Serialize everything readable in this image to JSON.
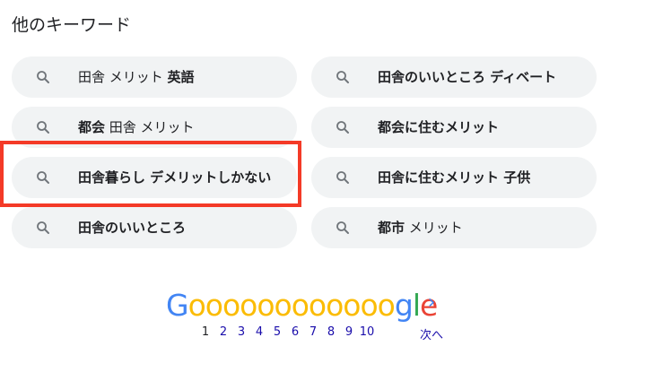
{
  "section_title": "他のキーワード",
  "left_chips": [
    {
      "plain": "田舎 メリット ",
      "bold": "英語"
    },
    {
      "bold": "都会",
      "plain": " 田舎 メリット",
      "underlined": true
    },
    {
      "bold": "田舎暮らし デメリットしかない",
      "plain": ""
    },
    {
      "bold": "田舎のいいところ",
      "plain": ""
    }
  ],
  "right_chips": [
    {
      "bold": "田舎のいいところ ディベート",
      "plain": ""
    },
    {
      "bold": "都会に住むメリット",
      "plain": ""
    },
    {
      "bold": "田舎に住むメリット 子供",
      "plain": ""
    },
    {
      "bold": "都市",
      "plain": " メリット"
    }
  ],
  "pagination": {
    "logo": {
      "G": "G",
      "o": "oooooooooooo",
      "g": "g",
      "l": "l",
      "e": "e"
    },
    "pages": [
      "1",
      "2",
      "3",
      "4",
      "5",
      "6",
      "7",
      "8",
      "9",
      "10"
    ],
    "current_page": "1",
    "next_label": "次へ",
    "next_icon": "chevron-right-icon"
  },
  "colors": {
    "chip_bg": "#f1f3f4",
    "highlight": "#f43a27",
    "link": "#1a0dab"
  }
}
